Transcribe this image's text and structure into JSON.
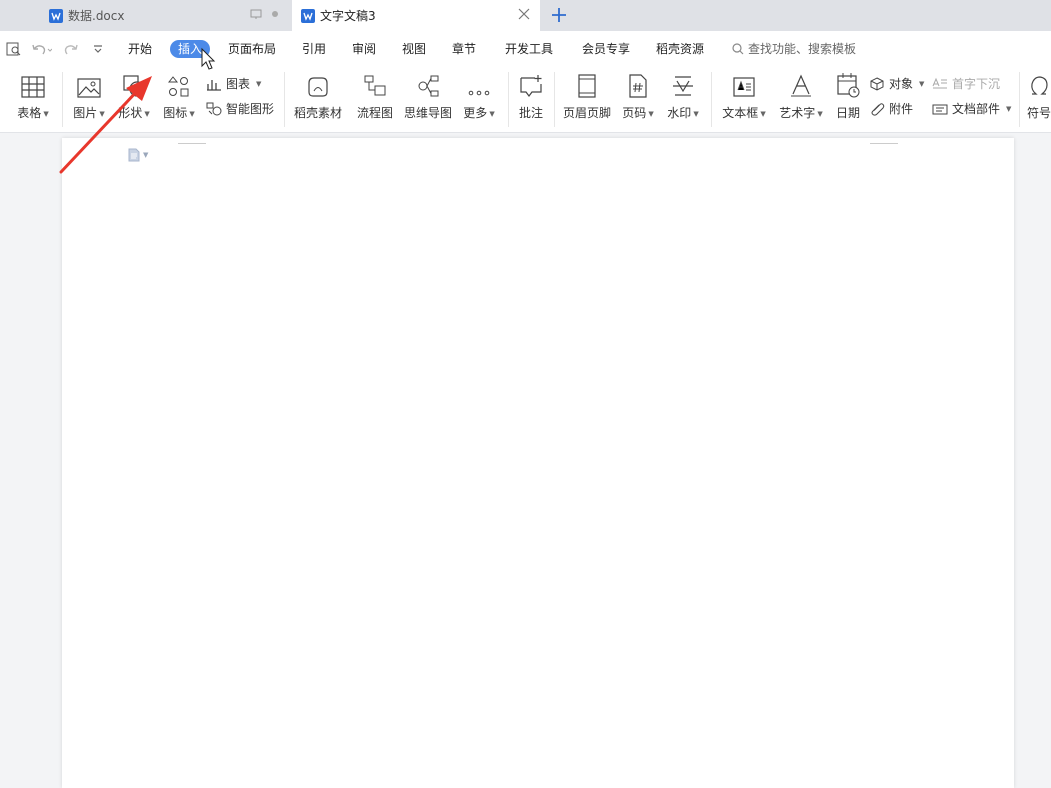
{
  "tabs": [
    {
      "title": "数据.docx",
      "active": false
    },
    {
      "title": "文字文稿3",
      "active": true
    }
  ],
  "menu": [
    "开始",
    "插入",
    "页面布局",
    "引用",
    "审阅",
    "视图",
    "章节",
    "开发工具",
    "会员专享",
    "稻壳资源"
  ],
  "active_menu": "插入",
  "search_placeholder": "查找功能、搜索模板",
  "ribbon": {
    "table": "表格",
    "picture": "图片",
    "shape": "形状",
    "icon": "图标",
    "chart": "图表",
    "smart_graphic": "智能图形",
    "docer_material": "稻壳素材",
    "flowchart": "流程图",
    "mindmap": "思维导图",
    "more": "更多",
    "comment": "批注",
    "header_footer": "页眉页脚",
    "page_number": "页码",
    "watermark": "水印",
    "textbox": "文本框",
    "wordart": "艺术字",
    "date": "日期",
    "object": "对象",
    "attachment": "附件",
    "drop_cap": "首字下沉",
    "doc_parts": "文档部件",
    "symbol": "符号"
  },
  "colors": {
    "accent": "#4c8ae8",
    "arrow": "#e8372c",
    "word_blue": "#2b6fd8"
  }
}
